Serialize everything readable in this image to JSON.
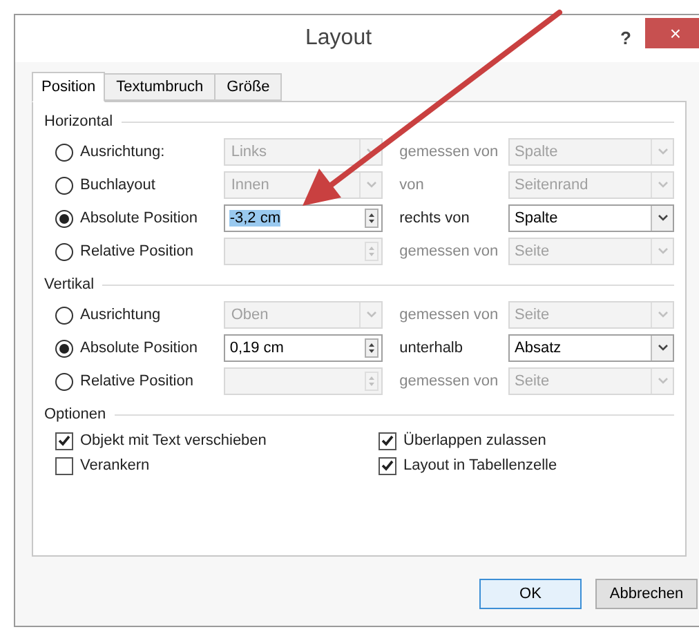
{
  "window": {
    "title": "Layout",
    "help": "?",
    "close": "×"
  },
  "tabs": [
    {
      "label": "Position",
      "selected": true
    },
    {
      "label": "Textumbruch",
      "selected": false
    },
    {
      "label": "Größe",
      "selected": false
    }
  ],
  "sections": [
    {
      "title": "Horizontal",
      "rows": [
        {
          "label": "Ausrichtung:",
          "selected": false,
          "kind": "select",
          "value": "Links",
          "disabled": true,
          "relation": "gemessen von",
          "reference": "Spalte"
        },
        {
          "label": "Buchlayout",
          "selected": false,
          "kind": "select",
          "value": "Innen",
          "disabled": true,
          "relation": "von",
          "reference": "Seitenrand"
        },
        {
          "label": "Absolute Position",
          "selected": true,
          "kind": "spin",
          "value": "-3,2 cm",
          "highlighted": true,
          "disabled": false,
          "relation": "rechts von",
          "reference": "Spalte"
        },
        {
          "label": "Relative Position",
          "selected": false,
          "kind": "spin",
          "disabled": true,
          "relation": "gemessen von",
          "reference": "Seite"
        }
      ]
    },
    {
      "title": "Vertikal",
      "rows": [
        {
          "label": "Ausrichtung",
          "selected": false,
          "kind": "select",
          "value": "Oben",
          "disabled": true,
          "relation": "gemessen von",
          "reference": "Seite"
        },
        {
          "label": "Absolute Position",
          "selected": true,
          "kind": "spin",
          "value": "0,19 cm",
          "highlighted": false,
          "disabled": false,
          "relation": "unterhalb",
          "reference": "Absatz"
        },
        {
          "label": "Relative Position",
          "selected": false,
          "kind": "spin",
          "disabled": true,
          "relation": "gemessen von",
          "reference": "Seite"
        }
      ]
    }
  ],
  "options": {
    "title": "Optionen",
    "items": [
      {
        "label": "Objekt mit Text verschieben",
        "checked": true
      },
      {
        "label": "Überlappen zulassen",
        "checked": true
      },
      {
        "label": "Verankern",
        "checked": false
      },
      {
        "label": "Layout in Tabellenzelle",
        "checked": true
      }
    ]
  },
  "buttons": [
    {
      "label": "OK",
      "default": true
    },
    {
      "label": "Abbrechen",
      "default": false
    }
  ]
}
